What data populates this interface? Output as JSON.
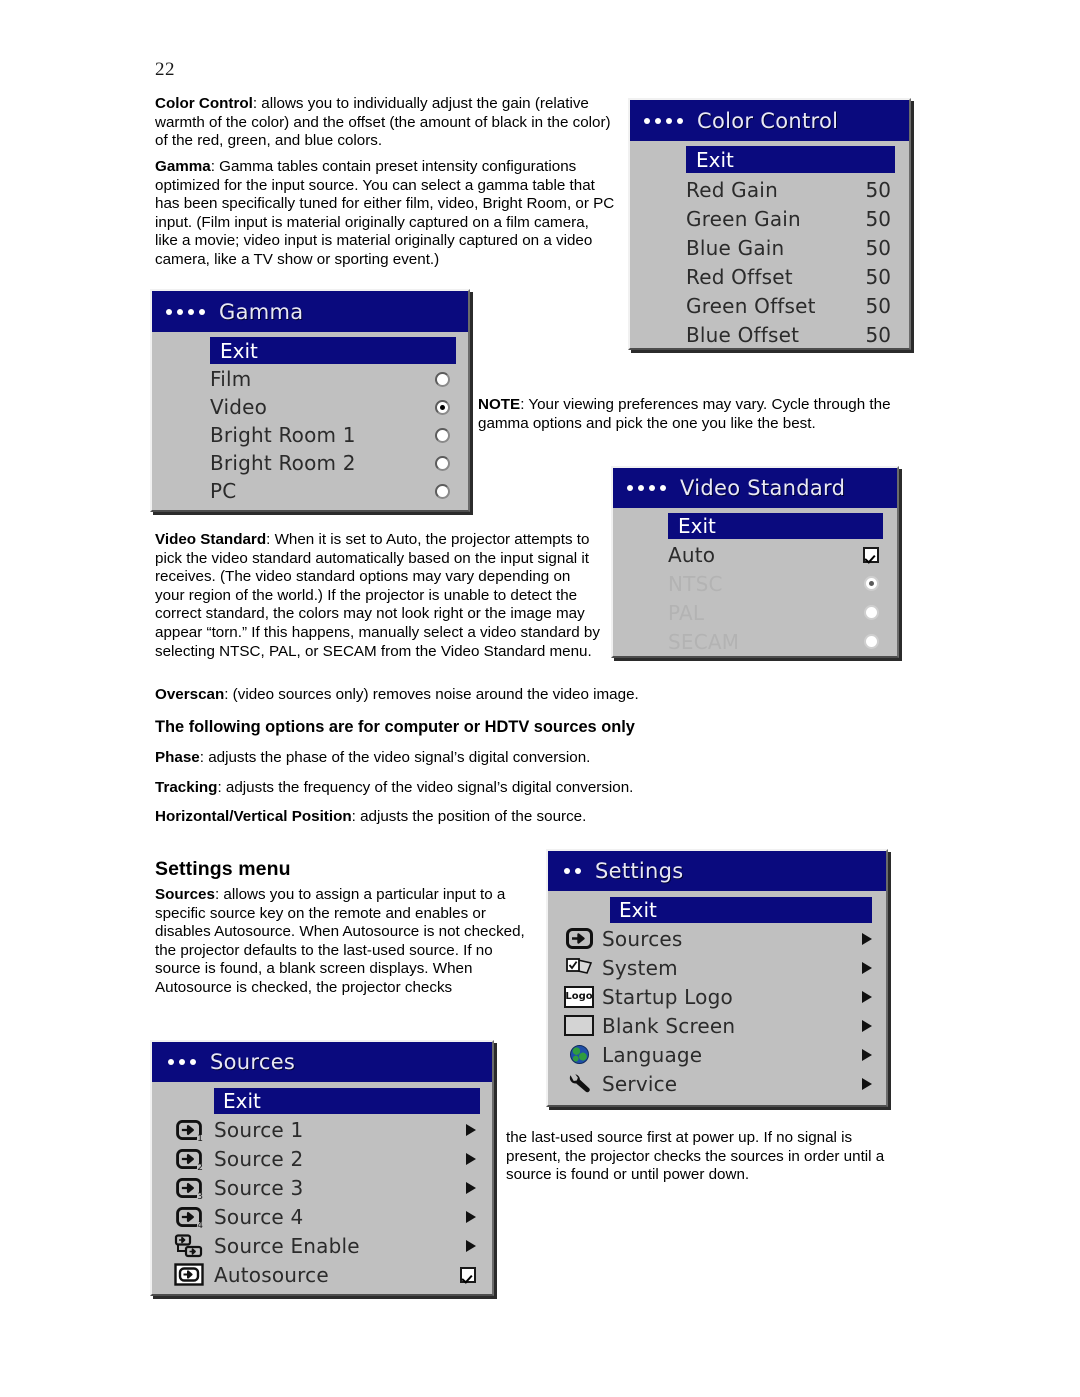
{
  "page": {
    "number": "22"
  },
  "body": {
    "color_control": {
      "term": "Color Control",
      "text": ": allows you to individually adjust the gain (relative warmth of the color) and the offset (the amount of black in the color) of the red, green, and blue colors."
    },
    "gamma": {
      "term": "Gamma",
      "text": ": Gamma tables contain preset intensity configurations optimized for the input source. You can select a gamma table that has been specifically tuned for either film, video, Bright Room, or PC input. (Film input is material originally captured on a film camera, like a movie; video input is material originally captured on a video camera, like a TV show or sporting event.)"
    },
    "note": {
      "term": "NOTE",
      "text": ": Your viewing preferences may vary. Cycle through the gamma options and pick the one you like the best."
    },
    "video_standard": {
      "term": "Video Standard",
      "text": ": When it is set to Auto, the projector attempts to pick the video standard automatically based on the input signal it receives. (The video standard options may vary depending on your region of the world.) If the projector is unable to detect the correct standard, the colors may not look right or the image may appear “torn.” If this happens, manually select a video standard by selecting NTSC, PAL, or SECAM from the Video Standard menu."
    },
    "overscan": {
      "term": "Overscan",
      "text": ": (video sources only) removes noise around the video image."
    },
    "hdtv_heading": "The following options are for computer or HDTV sources only",
    "phase": {
      "term": "Phase",
      "text": ": adjusts the phase of the video signal’s digital conversion."
    },
    "tracking": {
      "term": "Tracking",
      "text": ": adjusts the frequency of the video signal’s digital conversion."
    },
    "hv_position": {
      "term": "Horizontal/Vertical Position",
      "text": ": adjusts the position of the source."
    },
    "settings_heading": "Settings menu",
    "sources": {
      "term": "Sources",
      "text": ": allows you to assign a particular input to a specific source key on the remote and enables or disables Autosource. When Autosource is not checked, the projector defaults to the last-used source. If no source is found, a blank screen displays. When Autosource is checked, the projector checks"
    },
    "sources_cont": "the last-used source first at power up. If no signal is present, the projector checks the sources in order until a source is found or until power down."
  },
  "menus": {
    "color_control": {
      "title": "Color Control",
      "dots": 4,
      "exit_label": "Exit",
      "rows": [
        {
          "label": "Red Gain",
          "value": "50"
        },
        {
          "label": "Green Gain",
          "value": "50"
        },
        {
          "label": "Blue Gain",
          "value": "50"
        },
        {
          "label": "Red Offset",
          "value": "50"
        },
        {
          "label": "Green Offset",
          "value": "50"
        },
        {
          "label": "Blue Offset",
          "value": "50"
        }
      ]
    },
    "gamma": {
      "title": "Gamma",
      "dots": 4,
      "exit_label": "Exit",
      "rows": [
        {
          "label": "Film",
          "control": "radio",
          "selected": false
        },
        {
          "label": "Video",
          "control": "radio",
          "selected": true
        },
        {
          "label": "Bright Room 1",
          "control": "radio",
          "selected": false
        },
        {
          "label": "Bright Room 2",
          "control": "radio",
          "selected": false
        },
        {
          "label": "PC",
          "control": "radio",
          "selected": false
        }
      ]
    },
    "video_standard": {
      "title": "Video Standard",
      "dots": 4,
      "exit_label": "Exit",
      "rows": [
        {
          "label": "Auto",
          "control": "checkbox",
          "selected": true,
          "disabled": false
        },
        {
          "label": "NTSC",
          "control": "radio",
          "selected": true,
          "disabled": true
        },
        {
          "label": "PAL",
          "control": "radio",
          "selected": false,
          "disabled": true
        },
        {
          "label": "SECAM",
          "control": "radio",
          "selected": false,
          "disabled": true
        }
      ]
    },
    "settings": {
      "title": "Settings",
      "dots": 2,
      "exit_label": "Exit",
      "rows": [
        {
          "label": "Sources",
          "icon": "source-in-icon",
          "control": "submenu-arrow"
        },
        {
          "label": "System",
          "icon": "system-icon",
          "control": "submenu-arrow"
        },
        {
          "label": "Startup Logo",
          "icon": "logo-icon",
          "control": "submenu-arrow"
        },
        {
          "label": "Blank Screen",
          "icon": "blank-screen-icon",
          "control": "submenu-arrow"
        },
        {
          "label": "Language",
          "icon": "globe-icon",
          "control": "submenu-arrow"
        },
        {
          "label": "Service",
          "icon": "wrench-icon",
          "control": "submenu-arrow"
        }
      ]
    },
    "sources": {
      "title": "Sources",
      "dots": 3,
      "exit_label": "Exit",
      "rows": [
        {
          "label": "Source 1",
          "icon": "source-1-icon",
          "badge": "1",
          "control": "submenu-arrow"
        },
        {
          "label": "Source 2",
          "icon": "source-2-icon",
          "badge": "2",
          "control": "submenu-arrow"
        },
        {
          "label": "Source 3",
          "icon": "source-3-icon",
          "badge": "3",
          "control": "submenu-arrow"
        },
        {
          "label": "Source 4",
          "icon": "source-4-icon",
          "badge": "4",
          "control": "submenu-arrow"
        },
        {
          "label": "Source Enable",
          "icon": "source-enable-icon",
          "badge": "",
          "control": "submenu-arrow"
        },
        {
          "label": "Autosource",
          "icon": "autosource-icon",
          "badge": "",
          "control": "checkbox",
          "selected": true
        }
      ]
    }
  },
  "colors": {
    "menu_title_blue": "#0a0a7e",
    "menu_face_gray": "#c0c0c0",
    "disabled_text": "#b3b3b3"
  }
}
